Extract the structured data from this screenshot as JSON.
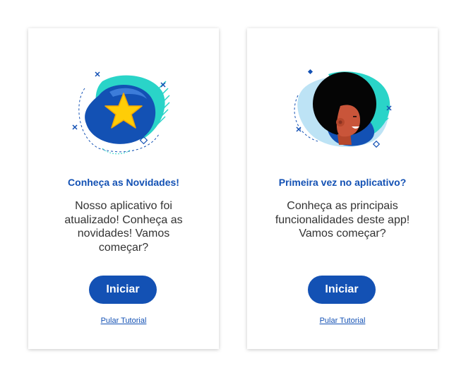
{
  "cards": [
    {
      "title": "Conheça as Novidades!",
      "description": "Nosso aplicativo foi atualizado! Conheça as novidades! Vamos começar?",
      "button_label": "Iniciar",
      "skip_label": "Pular Tutorial",
      "illustration": "star-icon"
    },
    {
      "title": "Primeira vez no aplicativo?",
      "description": "Conheça as principais funcionalidades deste app! Vamos começar?",
      "button_label": "Iniciar",
      "skip_label": "Pular Tutorial",
      "illustration": "person-avatar-icon"
    }
  ],
  "colors": {
    "primary": "#1351b4",
    "accent": "#2ad4c8",
    "star": "#ffcd07",
    "text": "#333333"
  }
}
